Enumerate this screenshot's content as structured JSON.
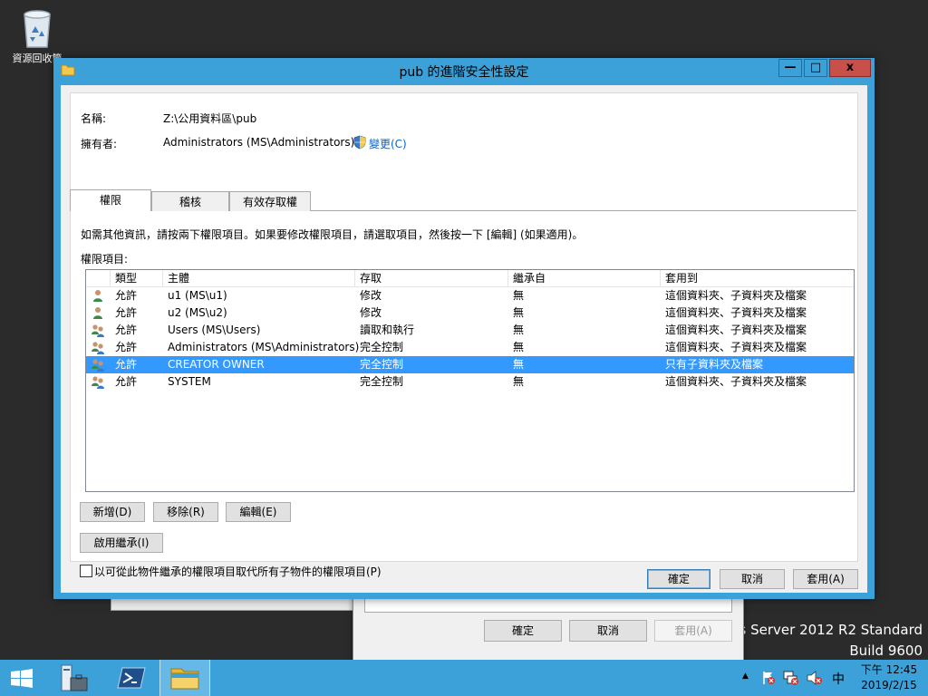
{
  "desktop": {
    "recycle_bin_label": "資源回收筒",
    "watermark_line1": "ws Server 2012 R2 Standard",
    "watermark_line2": "Build 9600"
  },
  "background_dialog": {
    "ok_label": "確定",
    "cancel_label": "取消",
    "apply_label": "套用(A)"
  },
  "window": {
    "title": "pub 的進階安全性設定",
    "minimize_glyph": "—",
    "maximize_glyph": "□",
    "close_glyph": "x"
  },
  "info": {
    "name_label": "名稱:",
    "name_value": "Z:\\公用資料區\\pub",
    "owner_label": "擁有者:",
    "owner_value": "Administrators (MS\\Administrators)",
    "change_link": "變更(C)"
  },
  "tabs": [
    {
      "label": "權限",
      "active": true
    },
    {
      "label": "稽核",
      "active": false
    },
    {
      "label": "有效存取權",
      "active": false
    }
  ],
  "instruction": "如需其他資訊，請按兩下權限項目。如果要修改權限項目，請選取項目，然後按一下 [編輯] (如果適用)。",
  "entries_label": "權限項目:",
  "table": {
    "columns": [
      "類型",
      "主體",
      "存取",
      "繼承自",
      "套用到"
    ],
    "rows": [
      {
        "icon": "user-icon",
        "type": "允許",
        "principal": "u1 (MS\\u1)",
        "access": "修改",
        "inherited": "無",
        "applies_to": "這個資料夾、子資料夾及檔案",
        "selected": false
      },
      {
        "icon": "user-icon",
        "type": "允許",
        "principal": "u2 (MS\\u2)",
        "access": "修改",
        "inherited": "無",
        "applies_to": "這個資料夾、子資料夾及檔案",
        "selected": false
      },
      {
        "icon": "group-icon",
        "type": "允許",
        "principal": "Users (MS\\Users)",
        "access": "讀取和執行",
        "inherited": "無",
        "applies_to": "這個資料夾、子資料夾及檔案",
        "selected": false
      },
      {
        "icon": "group-icon",
        "type": "允許",
        "principal": "Administrators (MS\\Administrators)",
        "access": "完全控制",
        "inherited": "無",
        "applies_to": "這個資料夾、子資料夾及檔案",
        "selected": false
      },
      {
        "icon": "group-icon",
        "type": "允許",
        "principal": "CREATOR OWNER",
        "access": "完全控制",
        "inherited": "無",
        "applies_to": "只有子資料夾及檔案",
        "selected": true
      },
      {
        "icon": "group-icon",
        "type": "允許",
        "principal": "SYSTEM",
        "access": "完全控制",
        "inherited": "無",
        "applies_to": "這個資料夾、子資料夾及檔案",
        "selected": false
      }
    ]
  },
  "buttons": {
    "add": "新增(D)",
    "remove": "移除(R)",
    "edit": "編輯(E)",
    "enable_inheritance": "啟用繼承(I)",
    "replace_checkbox": "以可從此物件繼承的權限項目取代所有子物件的權限項目(P)",
    "ok": "確定",
    "cancel": "取消",
    "apply": "套用(A)"
  },
  "taskbar": {
    "clock_time": "下午 12:45",
    "clock_date": "2019/2/15",
    "ime": "中",
    "tray_arrow": "▲"
  },
  "colors": {
    "window_frame": "#3ba1d8",
    "selection": "#3399ff",
    "link": "#0066cc",
    "close_button": "#c7504b"
  }
}
